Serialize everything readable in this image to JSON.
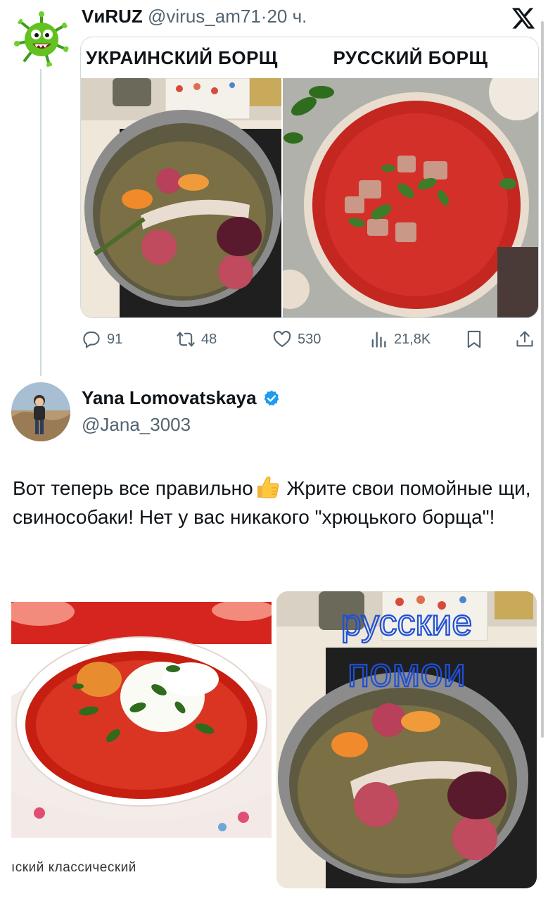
{
  "tweet": {
    "author_name": "VиRUZ",
    "handle": "@virus_am71",
    "separator": "·",
    "time": "20 ч.",
    "media": {
      "left_title": "УКРАИНСКИЙ БОРЩ",
      "right_title": "РУССКИЙ БОРЩ"
    },
    "stats": {
      "replies": "91",
      "retweets": "48",
      "likes": "530",
      "views": "21,8K"
    }
  },
  "reply": {
    "author_name": "Yana Lomovatskaya",
    "handle": "@Jana_3003",
    "text_part1": "Вот теперь все правильно",
    "text_part2": " Жрите свои помойные щи, свинособаки! Нет у вас никакого \"хрюцького борща\"!",
    "media": {
      "left_caption": "ıский классический",
      "right_overlay_line1": "русские",
      "right_overlay_line2": "помои"
    }
  },
  "icons": {
    "logo": "x-logo-icon",
    "reply": "speech-bubble-icon",
    "retweet": "retweet-arrows-icon",
    "like": "heart-icon",
    "views": "bar-chart-icon",
    "bookmark": "bookmark-icon",
    "share": "share-upload-icon",
    "verified": "verified-badge-icon",
    "emoji": "thumbs-up-emoji"
  },
  "colors": {
    "text": "#0f1419",
    "secondary_text": "#536471",
    "verified_blue": "#1d9bf0",
    "border": "#cfd9de",
    "overlay_text": "#1e4fd6"
  }
}
